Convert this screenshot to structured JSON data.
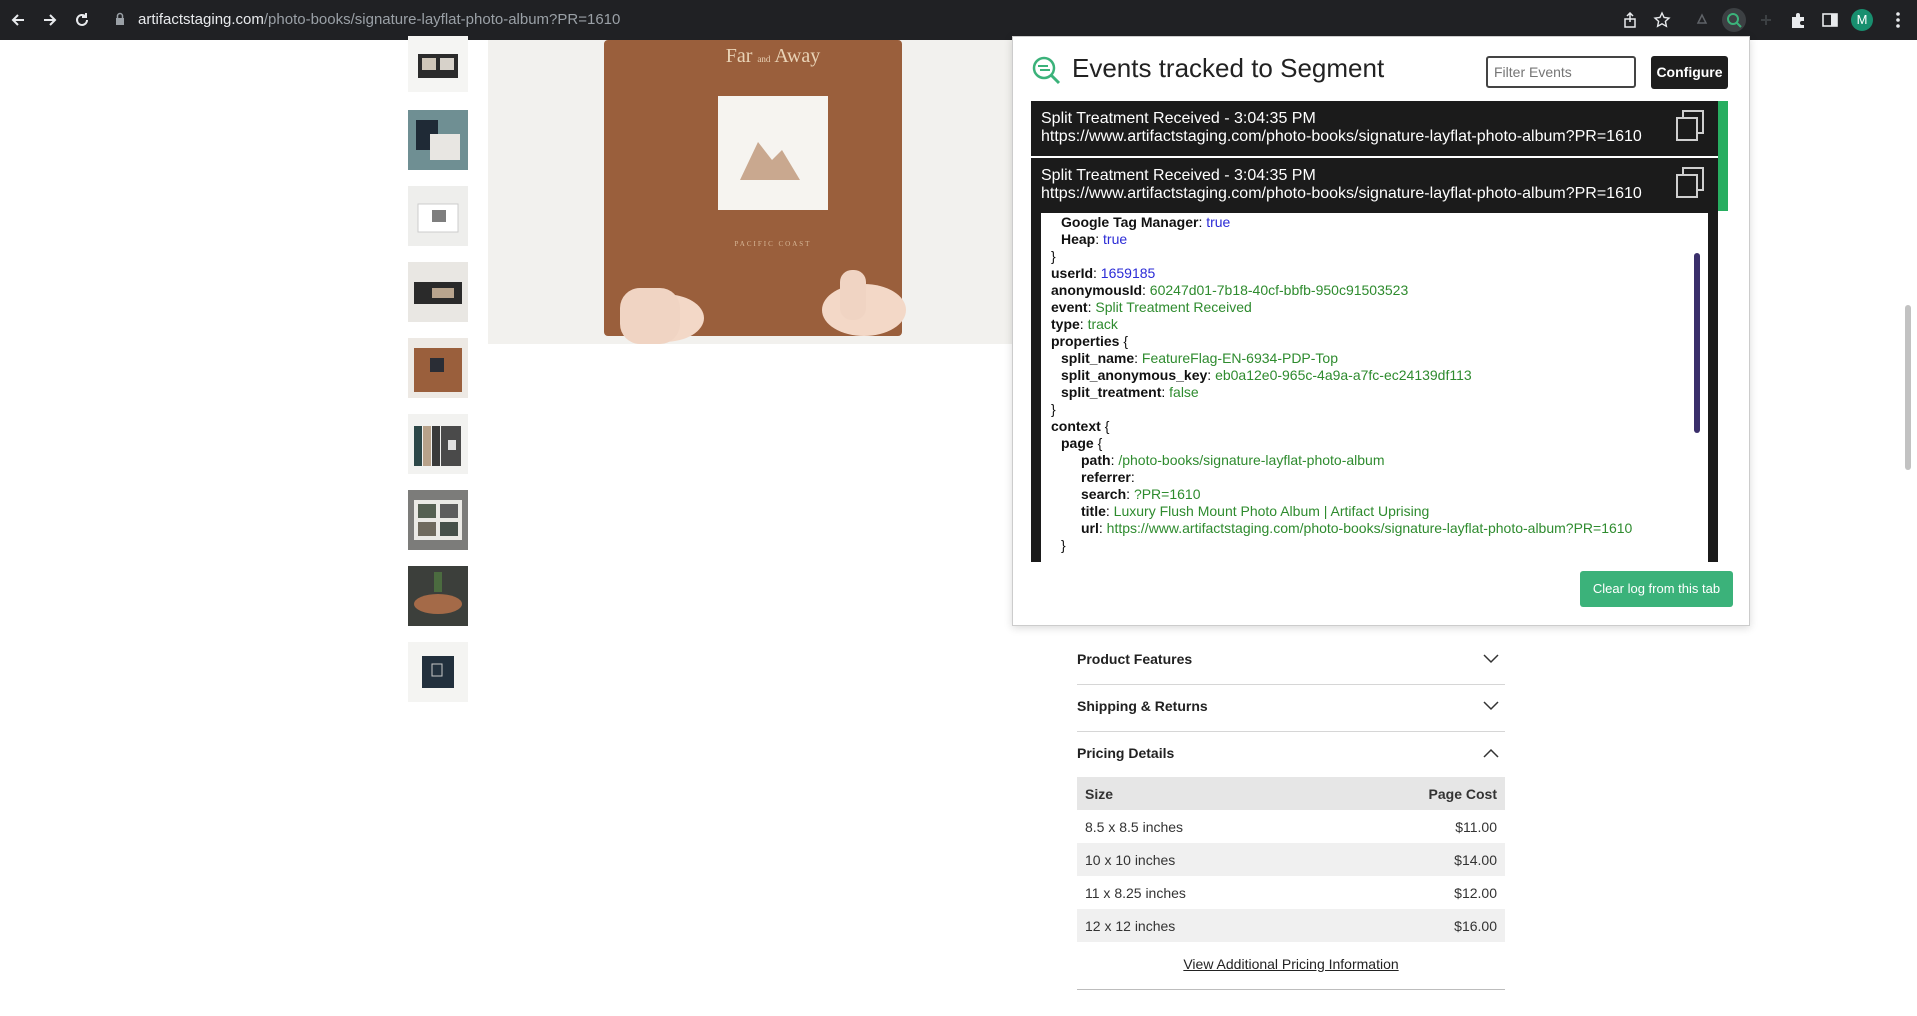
{
  "browser": {
    "url_domain": "artifactstaging.com",
    "url_path": "/photo-books/signature-layflat-photo-album?PR=1610",
    "avatar_letter": "M"
  },
  "hero": {
    "cover_title_left": "Far",
    "cover_title_amp": "and",
    "cover_title_right": "Away",
    "cover_subtitle": "PACIFIC COAST"
  },
  "segment": {
    "title": "Events tracked to Segment",
    "filter_placeholder": "Filter Events",
    "configure_label": "Configure",
    "clear_label": "Clear log from this tab",
    "events": [
      {
        "line1": "Split Treatment Received - 3:04:35 PM",
        "line2": "https://www.artifactstaging.com/photo-books/signature-layflat-photo-album?PR=1610"
      },
      {
        "line1": "Split Treatment Received - 3:04:35 PM",
        "line2": "https://www.artifactstaging.com/photo-books/signature-layflat-photo-album?PR=1610"
      }
    ],
    "detail": {
      "gtm_key": "Google Tag Manager",
      "gtm_val": "true",
      "heap_key": "Heap",
      "heap_val": "true",
      "close_brace": "}",
      "userId_key": "userId",
      "userId_val": "1659185",
      "anon_key": "anonymousId",
      "anon_val": "60247d01-7b18-40cf-bbfb-950c91503523",
      "event_key": "event",
      "event_val": "Split Treatment Received",
      "type_key": "type",
      "type_val": "track",
      "props_key": "properties",
      "open_brace": "{",
      "split_name_key": "split_name",
      "split_name_val": "FeatureFlag-EN-6934-PDP-Top",
      "split_anon_key": "split_anonymous_key",
      "split_anon_val": "eb0a12e0-965c-4a9a-a7fc-ec24139df113",
      "split_treat_key": "split_treatment",
      "split_treat_val": "false",
      "context_key": "context",
      "page_key": "page",
      "path_key": "path",
      "path_val": "/photo-books/signature-layflat-photo-album",
      "referrer_key": "referrer",
      "search_key": "search",
      "search_val": "?PR=1610",
      "title_key": "title",
      "title_val": "Luxury Flush Mount Photo Album | Artifact Uprising",
      "url_key": "url",
      "url_val": "https://www.artifactstaging.com/photo-books/signature-layflat-photo-album?PR=1610"
    }
  },
  "product": {
    "accordion": [
      {
        "label": "Product Features",
        "open": false
      },
      {
        "label": "Shipping & Returns",
        "open": false
      },
      {
        "label": "Pricing Details",
        "open": true
      }
    ],
    "pricing": {
      "headers": [
        "Size",
        "Page Cost"
      ],
      "rows": [
        [
          "8.5 x 8.5 inches",
          "$11.00"
        ],
        [
          "10 x 10 inches",
          "$14.00"
        ],
        [
          "11 x 8.25 inches",
          "$12.00"
        ],
        [
          "12 x 12 inches",
          "$16.00"
        ]
      ],
      "view_more": "View Additional Pricing Information"
    }
  },
  "colors": {
    "chrome_bg": "#202124",
    "segment_green": "#3bb27a",
    "event_bg": "#1b1b1b",
    "book_cover": "#9a5f3c"
  }
}
